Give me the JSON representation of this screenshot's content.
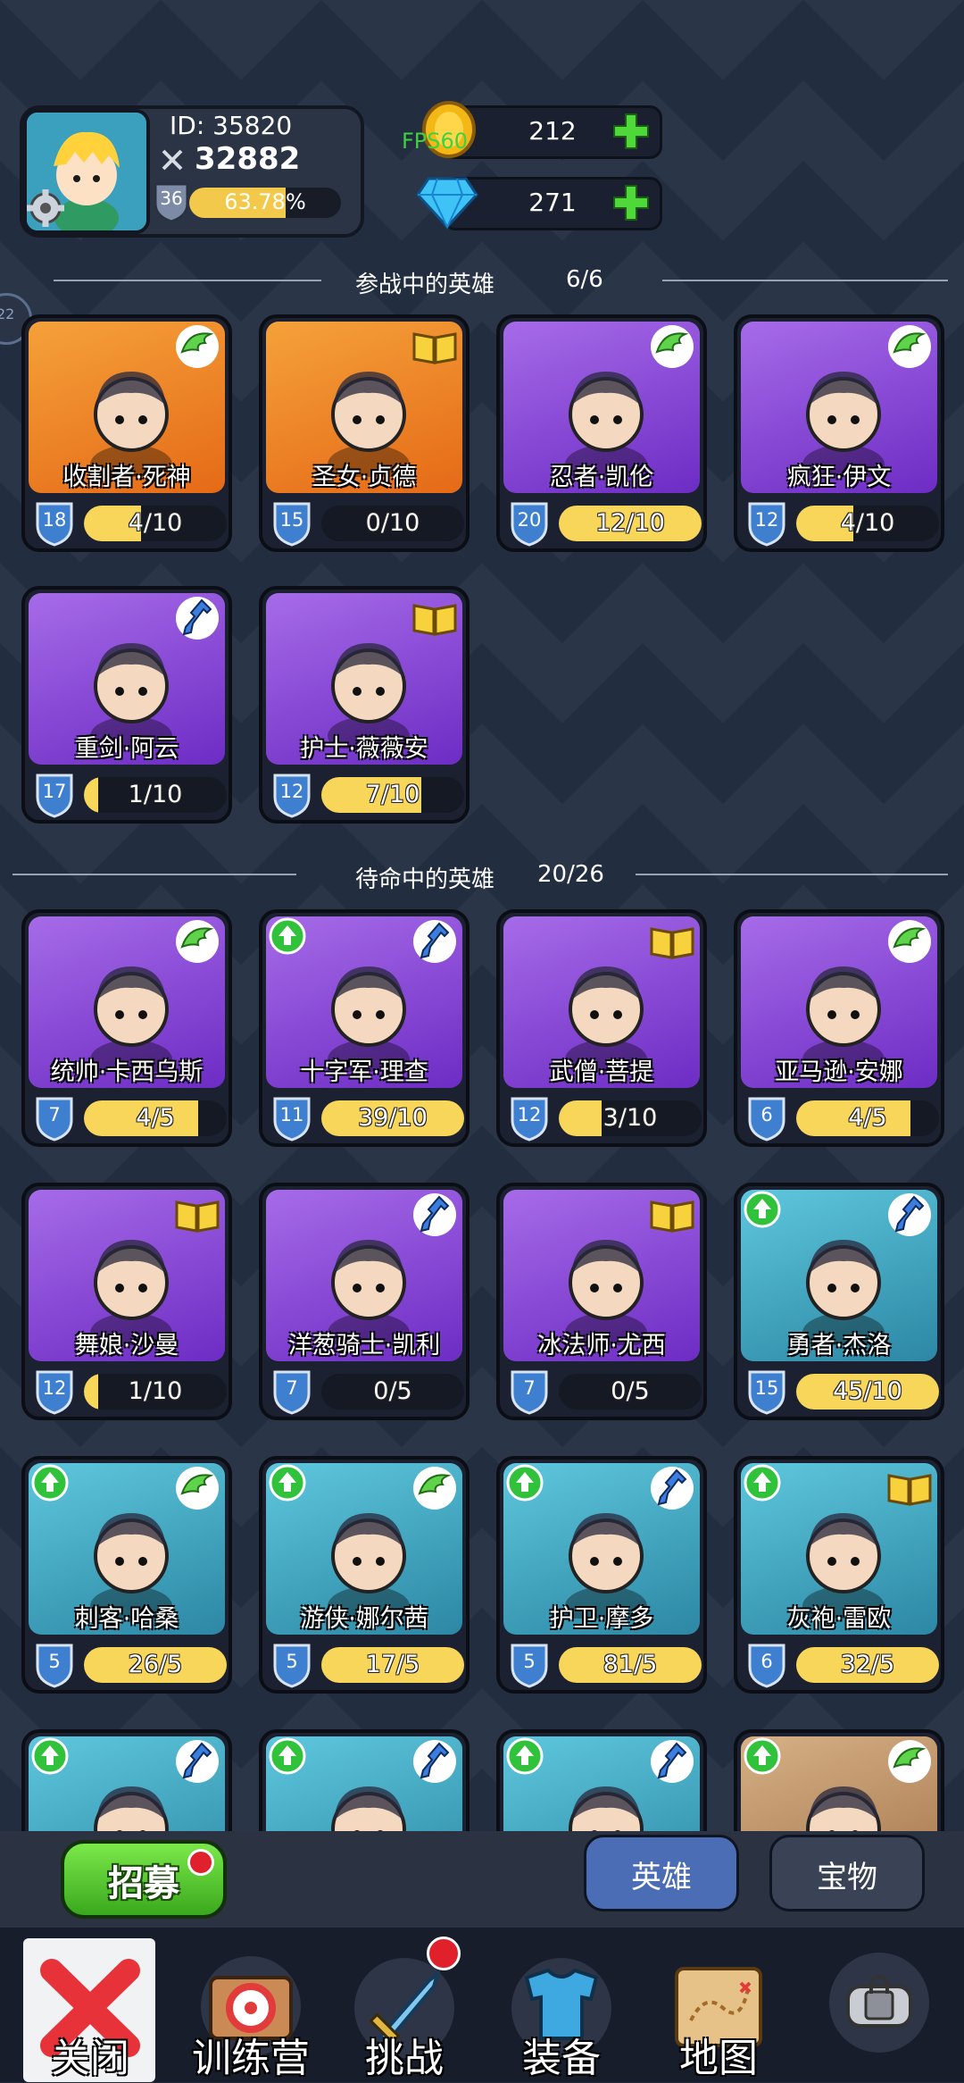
{
  "profile": {
    "id_text": "ID: 35820",
    "power": "32882",
    "level": "36",
    "exp_text": "63.78%",
    "exp_fraction": 0.6378
  },
  "fps": "FPS60",
  "resources": {
    "gold": "212",
    "diamond": "271"
  },
  "active_section": {
    "title": "参战中的英雄",
    "count": "6/6"
  },
  "standby_section": {
    "title": "待命中的英雄",
    "count": "20/26"
  },
  "side_counter": "22",
  "active_heroes": [
    {
      "name": "收割者·死神",
      "level": "18",
      "progress": "4/10",
      "fill": 0.4,
      "bg": "orange",
      "tag": "wing",
      "upgrade": false
    },
    {
      "name": "圣女·贞德",
      "level": "15",
      "progress": "0/10",
      "fill": 0,
      "bg": "orange",
      "tag": "book",
      "upgrade": false
    },
    {
      "name": "忍者·凯伦",
      "level": "20",
      "progress": "12/10",
      "fill": 1,
      "bg": "purple",
      "tag": "wing",
      "upgrade": false
    },
    {
      "name": "疯狂·伊文",
      "level": "12",
      "progress": "4/10",
      "fill": 0.4,
      "bg": "purple",
      "tag": "wing",
      "upgrade": false
    },
    {
      "name": "重剑·阿云",
      "level": "17",
      "progress": "1/10",
      "fill": 0.1,
      "bg": "purple",
      "tag": "potion",
      "upgrade": false
    },
    {
      "name": "护士·薇薇安",
      "level": "12",
      "progress": "7/10",
      "fill": 0.7,
      "bg": "purple",
      "tag": "book",
      "upgrade": false
    }
  ],
  "standby_heroes": [
    {
      "name": "统帅·卡西乌斯",
      "level": "7",
      "progress": "4/5",
      "fill": 0.8,
      "bg": "purple",
      "tag": "wing",
      "upgrade": false
    },
    {
      "name": "十字军·理查",
      "level": "11",
      "progress": "39/10",
      "fill": 1,
      "bg": "purple",
      "tag": "potion",
      "upgrade": true
    },
    {
      "name": "武僧·菩提",
      "level": "12",
      "progress": "3/10",
      "fill": 0.3,
      "bg": "purple",
      "tag": "book",
      "upgrade": false
    },
    {
      "name": "亚马逊·安娜",
      "level": "6",
      "progress": "4/5",
      "fill": 0.8,
      "bg": "purple",
      "tag": "wing",
      "upgrade": false
    },
    {
      "name": "舞娘·沙曼",
      "level": "12",
      "progress": "1/10",
      "fill": 0.1,
      "bg": "purple",
      "tag": "book",
      "upgrade": false
    },
    {
      "name": "洋葱骑士·凯利",
      "level": "7",
      "progress": "0/5",
      "fill": 0,
      "bg": "purple",
      "tag": "potion",
      "upgrade": false
    },
    {
      "name": "冰法师·尤西",
      "level": "7",
      "progress": "0/5",
      "fill": 0,
      "bg": "purple",
      "tag": "book",
      "upgrade": false
    },
    {
      "name": "勇者·杰洛",
      "level": "15",
      "progress": "45/10",
      "fill": 1,
      "bg": "teal",
      "tag": "potion",
      "upgrade": true
    },
    {
      "name": "刺客·哈桑",
      "level": "5",
      "progress": "26/5",
      "fill": 1,
      "bg": "teal",
      "tag": "wing",
      "upgrade": true
    },
    {
      "name": "游侠·娜尔茜",
      "level": "5",
      "progress": "17/5",
      "fill": 1,
      "bg": "teal",
      "tag": "wing",
      "upgrade": true
    },
    {
      "name": "护卫·摩多",
      "level": "5",
      "progress": "81/5",
      "fill": 1,
      "bg": "teal",
      "tag": "potion",
      "upgrade": true
    },
    {
      "name": "灰袍·雷欧",
      "level": "6",
      "progress": "32/5",
      "fill": 1,
      "bg": "teal",
      "tag": "book",
      "upgrade": true
    },
    {
      "name": "",
      "level": "",
      "progress": "",
      "fill": 0,
      "bg": "teal",
      "tag": "potion",
      "upgrade": true
    },
    {
      "name": "",
      "level": "",
      "progress": "",
      "fill": 0,
      "bg": "teal",
      "tag": "potion",
      "upgrade": true
    },
    {
      "name": "",
      "level": "",
      "progress": "",
      "fill": 0,
      "bg": "teal",
      "tag": "potion",
      "upgrade": true
    },
    {
      "name": "",
      "level": "",
      "progress": "",
      "fill": 0,
      "bg": "tan",
      "tag": "wing",
      "upgrade": true
    }
  ],
  "recruit_label": "招募",
  "tabs": {
    "heroes": "英雄",
    "treasure": "宝物"
  },
  "nav": {
    "close": "关闭",
    "training": "训练营",
    "challenge": "挑战",
    "equipment": "装备",
    "map": "地图"
  },
  "colors": {
    "gold_bar": "#f7d65a",
    "green_button": "#3aa81d",
    "red_dot": "#e0202a",
    "active_tab": "#4b6db5"
  }
}
